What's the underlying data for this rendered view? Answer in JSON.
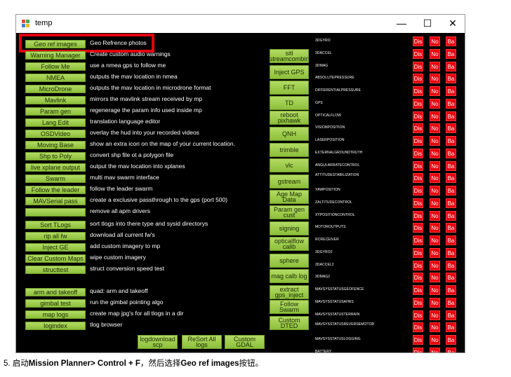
{
  "window": {
    "title": "temp",
    "minimize": "—",
    "maximize": "☐",
    "close": "✕"
  },
  "left_buttons": [
    {
      "label": "Geo ref images",
      "desc": "Geo Refrence photos"
    },
    {
      "label": "Warning Manager",
      "desc": "Create custom audio warnings"
    },
    {
      "label": "Follow Me",
      "desc": "use a nmea gps to follow me"
    },
    {
      "label": "NMEA",
      "desc": "outputs the mav location in nmea"
    },
    {
      "label": "MicroDrone",
      "desc": "outputs the mav location in microdrone format"
    },
    {
      "label": "Mavlink",
      "desc": "mirrors the mavlink stream received by mp"
    },
    {
      "label": "Param gen",
      "desc": "regenerage the param info used inside mp"
    },
    {
      "label": "Lang Edit",
      "desc": "translation language editor"
    },
    {
      "label": "OSDVideo",
      "desc": "overlay the hud into your recorded videos"
    },
    {
      "label": "Moving Base",
      "desc": "show an extra icon on the map of your current location."
    },
    {
      "label": "Shp to Poly",
      "desc": "convert shp file ot a polygon file"
    },
    {
      "label": "live xplane output",
      "desc": "output the mav location into xplanes"
    },
    {
      "label": "Swarm",
      "desc": "multi mav swarm interface"
    },
    {
      "label": "Follow the leader",
      "desc": "follow the leader swarm"
    },
    {
      "label": "MAVSerial pass",
      "desc": "create a exclusive passthrough to the gps (port 500)"
    },
    {
      "label": "",
      "desc": "remove all apm drivers"
    },
    {
      "label": "Sort TLogs",
      "desc": "sort tlogs into there type and sysid directorys"
    },
    {
      "label": "rip all fw",
      "desc": "download all current fw's"
    },
    {
      "label": "Inject GE",
      "desc": "add custom imagery to mp"
    },
    {
      "label": "Clear Custom Maps",
      "desc": "wipe custom imagery"
    },
    {
      "label": "structtest",
      "desc": "struct conversion speed test"
    },
    {
      "label": "arm and takeoff",
      "desc": "quad: arm and takeoff"
    },
    {
      "label": "gimbal test",
      "desc": "run the gimbal pointing algo"
    },
    {
      "label": "map logs",
      "desc": "create map jpg's for all tlogs in a dir"
    },
    {
      "label": "logindex",
      "desc": "tlog browser"
    }
  ],
  "bottom_buttons": [
    "logdownload scp",
    "ReSort All logs",
    "Custom GDAL"
  ],
  "mid_buttons": [
    "sitl streamcombin",
    "Inject GPS",
    "FFT",
    "TD",
    "reboot pixhawk",
    "QNH",
    "trimble",
    "vlc",
    "gstream",
    "Age Map Data",
    "Param gen cust",
    "signing",
    "opticalflow calib",
    "sphere",
    "mag calb log",
    "extract gps_inject",
    "Follow Swarm",
    "Custom DTED"
  ],
  "sensor_labels": [
    "3DGYRO",
    "3DACCEL",
    "3DMAG",
    "ABSOLUTEPRESSURE",
    "DIFFERENTIALPRESSURE",
    "GPS",
    "OPTICALFLOW",
    "VISIONPOSITION",
    "LASERPOSITION",
    "EXTERNALGROUNDTRUTH",
    "ANGULARRATECONTROL",
    "ATTITUDESTABILIZATION",
    "YAWPOSITION",
    "ZALTITUDECONTROL",
    "XYPOSITIONCONTROL",
    "MOTOROUTPUTS",
    "RCRECEIVER",
    "3DGYRO2",
    "3DACCEL2",
    "3DMAG2",
    "MAVSYSSTATUSGEOFENCE",
    "MAVSYSSTATUSAHRS",
    "MAVSYSSTATUSTERRAIN",
    "MAVSYSSTATUSREVERSEMOTOR",
    "MAVSYSSTATUSLOGGING",
    "BATTERY"
  ],
  "sensor_button_labels": {
    "dis": "Dis",
    "no": "No",
    "ba": "Ba"
  },
  "caption": {
    "prefix": "5. 启动",
    "app": "Mission Planner",
    "keys": "> Control + F",
    "middle": "，然后选择",
    "button": "Geo ref images",
    "suffix": "按钮。"
  },
  "colors": {
    "button_green": "#9fcf4f",
    "sensor_red": "#e8000d",
    "highlight_red": "#e3000f"
  }
}
